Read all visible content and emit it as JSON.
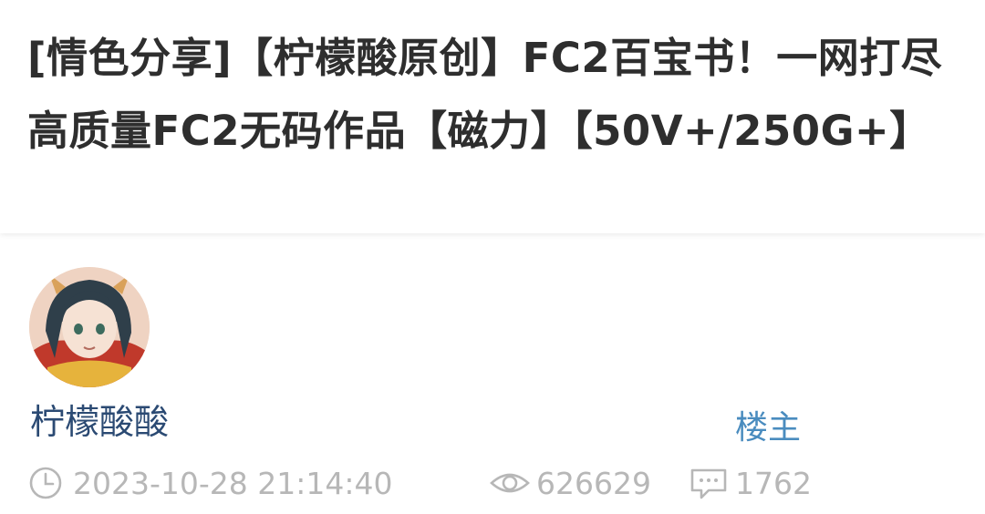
{
  "post": {
    "title": "[情色分享]【柠檬酸原创】FC2百宝书！一网打尽高质量FC2无码作品【磁力】【50V+/250G+】"
  },
  "author": {
    "name": "柠檬酸酸",
    "role_badge": "楼主"
  },
  "meta": {
    "timestamp": "2023-10-28 21:14:40",
    "views": "626629",
    "replies": "1762",
    "icons": [
      "clock-icon",
      "eye-icon",
      "comment-icon"
    ]
  },
  "colors": {
    "title": "#2e2e2e",
    "author_name": "#2b4a73",
    "op_badge": "#4a8cbf",
    "meta": "#b7b7b7"
  }
}
